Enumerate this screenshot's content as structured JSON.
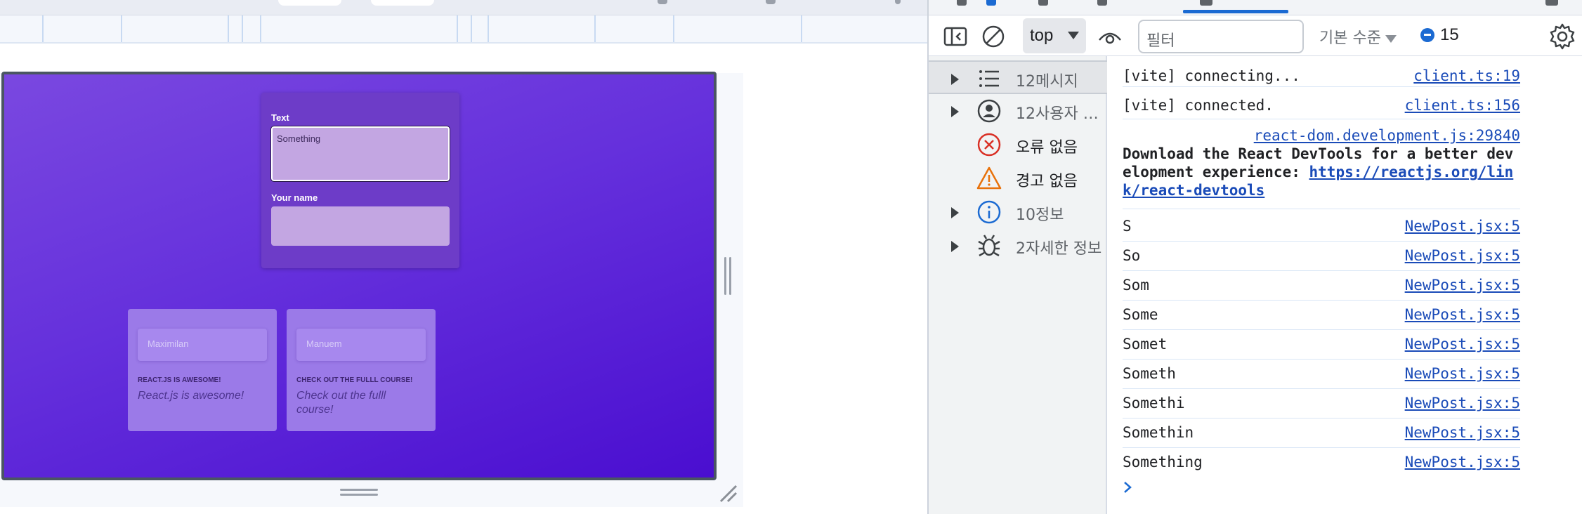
{
  "app": {
    "form": {
      "text_label": "Text",
      "text_value": "Something",
      "name_label": "Your name",
      "name_value": ""
    },
    "posts": [
      {
        "author": "Maximilan",
        "title": "REACT.JS IS AWESOME!",
        "body": "React.js is awesome!"
      },
      {
        "author": "Manuem",
        "title": "CHECK OUT THE FULLL COURSE!",
        "body": "Check out the fulll course!"
      }
    ],
    "colors": {
      "gradient_start": "#7a48e0",
      "gradient_end": "#4a0ed0",
      "card": "#9b7ae8",
      "form": "#6d3cc8"
    }
  },
  "devtools": {
    "toolbar": {
      "sidebar_toggle_icon": "sidebar-toggle-icon",
      "clear_icon": "clear-console-icon",
      "context": "top",
      "eye_icon": "live-expression-icon",
      "filter_placeholder": "필터",
      "levels_label": "기본 수준",
      "issues_count": "15",
      "settings_icon": "gear-icon"
    },
    "sidebar": [
      {
        "label": "12메시지",
        "icon": "list-icon",
        "expandable": true,
        "selected": true
      },
      {
        "label": "12사용자 …",
        "icon": "user-icon",
        "expandable": true,
        "selected": false
      },
      {
        "label": "오류 없음",
        "icon": "error-icon",
        "expandable": false,
        "selected": false
      },
      {
        "label": "경고 없음",
        "icon": "warning-icon",
        "expandable": false,
        "selected": false
      },
      {
        "label": "10정보",
        "icon": "info-icon",
        "expandable": true,
        "selected": false
      },
      {
        "label": "2자세한 정보",
        "icon": "bug-icon",
        "expandable": true,
        "selected": false
      }
    ],
    "console": {
      "vite_logs": [
        {
          "msg": "[vite] connecting...",
          "src": "client.ts:19"
        },
        {
          "msg": "[vite] connected.",
          "src": "client.ts:156"
        }
      ],
      "react_devtools": {
        "src": "react-dom.development.js:29840",
        "text": "Download the React DevTools for a better development experience: ",
        "link": "https://reactjs.org/link/react-devtools"
      },
      "logs": [
        {
          "msg": "S",
          "src": "NewPost.jsx:5"
        },
        {
          "msg": "So",
          "src": "NewPost.jsx:5"
        },
        {
          "msg": "Som",
          "src": "NewPost.jsx:5"
        },
        {
          "msg": "Some",
          "src": "NewPost.jsx:5"
        },
        {
          "msg": "Somet",
          "src": "NewPost.jsx:5"
        },
        {
          "msg": "Someth",
          "src": "NewPost.jsx:5"
        },
        {
          "msg": "Somethi",
          "src": "NewPost.jsx:5"
        },
        {
          "msg": "Somethin",
          "src": "NewPost.jsx:5"
        },
        {
          "msg": "Something",
          "src": "NewPost.jsx:5"
        }
      ]
    }
  }
}
